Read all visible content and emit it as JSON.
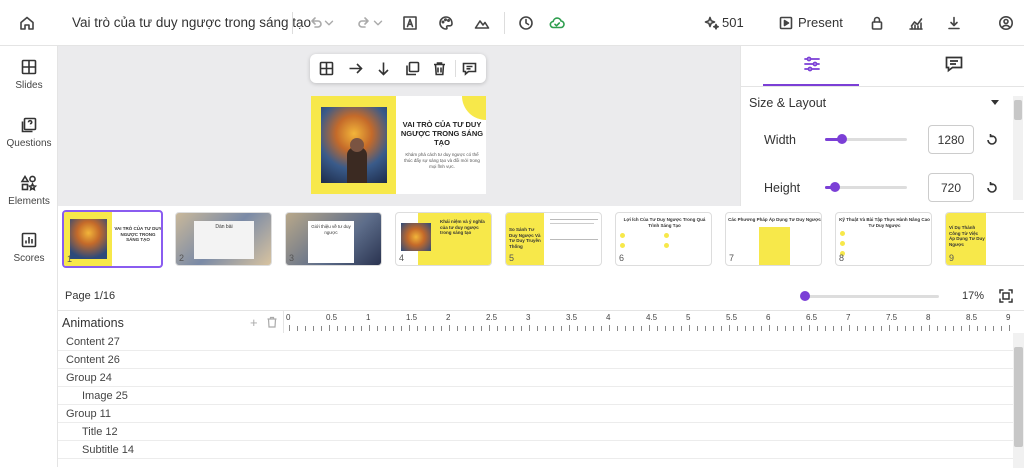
{
  "topbar": {
    "title": "Vai trò của tư duy ngược trong sáng tạo",
    "credits": "501",
    "present_label": "Present"
  },
  "sidebar": {
    "items": [
      {
        "label": "Slides",
        "icon": "layout-icon"
      },
      {
        "label": "Questions",
        "icon": "question-icon"
      },
      {
        "label": "Elements",
        "icon": "elements-icon"
      },
      {
        "label": "Scores",
        "icon": "chart-icon"
      }
    ]
  },
  "slide": {
    "title": "VAI TRÒ CỦA TƯ DUY NGƯỢC TRONG SÁNG TẠO",
    "subtitle": "Khám phá cách tư duy ngược có thể thúc đẩy sự sáng tạo và đổi mới trong mọi lĩnh vực."
  },
  "right_panel": {
    "section": "Size & Layout",
    "width_label": "Width",
    "width_value": "1280",
    "height_label": "Height",
    "height_value": "720"
  },
  "thumbnails": [
    {
      "num": "1",
      "title": "VAI TRÒ CỦA TƯ DUY NGƯỢC TRONG SÁNG TẠO"
    },
    {
      "num": "2",
      "title": "Dàn bài"
    },
    {
      "num": "3",
      "title": "Giới thiệu về tư duy ngược"
    },
    {
      "num": "4",
      "title": "Khái niệm và ý nghĩa của tư duy ngược trong sáng tạo"
    },
    {
      "num": "5",
      "title": "So Sánh Tư Duy Ngược Và Tư Duy Truyền Thống"
    },
    {
      "num": "6",
      "title": "Lợi Ích Của Tư Duy Ngược Trong Quá Trình Sáng Tạo"
    },
    {
      "num": "7",
      "title": "Các Phương Pháp Áp Dụng Tư Duy Ngược"
    },
    {
      "num": "8",
      "title": "Kỹ Thuật Và Bài Tập Thực Hành Nâng Cao Tư Duy Ngược"
    },
    {
      "num": "9",
      "title": "Ví Dụ Thành Công Từ Việc Áp Dụng Tư Duy Ngược"
    }
  ],
  "page": {
    "label": "Page 1/16",
    "zoom": "17%",
    "zoom_fraction": 0.17
  },
  "animations": {
    "title": "Animations",
    "layers": [
      {
        "label": "Content 27",
        "indent": false
      },
      {
        "label": "Content 26",
        "indent": false
      },
      {
        "label": "Group 24",
        "indent": false
      },
      {
        "label": "Image 25",
        "indent": true
      },
      {
        "label": "Group 11",
        "indent": false
      },
      {
        "label": "Title 12",
        "indent": true
      },
      {
        "label": "Subtitle 14",
        "indent": true
      }
    ],
    "ruler": [
      "0",
      "0.5",
      "1",
      "1.5",
      "2",
      "2.5",
      "3",
      "3.5",
      "4",
      "4.5",
      "5",
      "5.5",
      "6",
      "6.5",
      "7",
      "7.5",
      "8",
      "8.5",
      "9"
    ]
  },
  "colors": {
    "accent": "#7b3fd6",
    "slide_yellow": "#f7e84a",
    "sync_green": "#2e9e4e"
  }
}
